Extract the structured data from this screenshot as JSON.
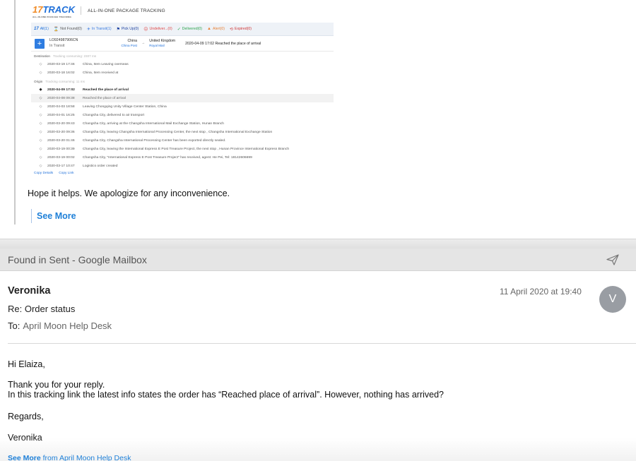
{
  "quoted": {
    "brand_logo": "17TRACK",
    "brand_logo_sub": "ALL-IN-ONE PACKAGE TRACKING",
    "brand_title": "ALL-IN-ONE PACKAGE TRACKING",
    "tabs": [
      {
        "label": "All(1)"
      },
      {
        "label": "Not Found(0)"
      },
      {
        "label": "In Transit(1)"
      },
      {
        "label": "Pick Up(0)"
      },
      {
        "label": "Undeliver...(0)"
      },
      {
        "label": "Delivered(0)"
      },
      {
        "label": "Alert(0)"
      },
      {
        "label": "Expired(0)"
      }
    ],
    "package": {
      "plus": "+",
      "tracking_number": "LO924987906CN",
      "status": "In Transit",
      "origin_country": "China",
      "origin_carrier": "China Post",
      "arrow": "→",
      "dest_country": "United Kingdom",
      "dest_carrier": "Royal Mail",
      "latest": "2020-04-09 17:02  Reached the place of arrival"
    },
    "destination": {
      "label": "Destination",
      "consuming": "Tracking consuming: 2307 ms",
      "events": [
        {
          "time": "2020-03-19 17:46",
          "text": "China, Item Leaving overseas"
        },
        {
          "time": "2020-03-18 16:02",
          "text": "China, Item received at"
        }
      ]
    },
    "origin": {
      "label": "Origin",
      "consuming": "Tracking consuming: 11 ms",
      "events": [
        {
          "time": "2020-04-09 17:02",
          "text": "Reached the place of arrival"
        },
        {
          "time": "2020-04-08 09:38",
          "text": "Reached the place of arrival"
        },
        {
          "time": "2020-04-03 18:58",
          "text": "Leaving Chongqing Unity Village Center Station, China"
        },
        {
          "time": "2020-04-01 16:25",
          "text": "Changsha City, delivered to air transport"
        },
        {
          "time": "2020-03-20 09:43",
          "text": "Changsha City, arriving at the Changsha International Mail Exchange Station, Hunan Branch"
        },
        {
          "time": "2020-03-20 09:36",
          "text": "Changsha City, leaving Changsha International Processing Center, the next stop , Changsha International Exchange Station"
        },
        {
          "time": "2020-03-20 01:46",
          "text": "Changsha City, Changsha International Processing Center has been exported directly sealed."
        },
        {
          "time": "2020-03-19 00:39",
          "text": "Changsha City, leaving the International Express E Post Treasure Project, the next stop , Hunan Province International Express Branch"
        },
        {
          "time": "2020-03-19 00:02",
          "text": "Changsha City, \"International Express E Post Treasure Project\" has received, agent: He Pei, Tel: 18142606699"
        },
        {
          "time": "2020-03-17 10:47",
          "text": "Logistics order created"
        }
      ]
    },
    "copy_details": "Copy Details",
    "copy_link": "Copy Link",
    "hope_text": "Hope it helps. We apologize for any inconvenience.",
    "see_more": "See More"
  },
  "search_header": {
    "text": "Found in Sent - Google Mailbox"
  },
  "email": {
    "sender": "Veronika",
    "date": "11 April 2020 at 19:40",
    "avatar_initial": "V",
    "subject": "Re: Order status",
    "to_label": "To:",
    "to_value": "April Moon Help Desk",
    "body": {
      "greeting": "Hi Elaiza,",
      "line1": "Thank you for your reply.",
      "line2": "In this tracking link the latest info states the order has “Reached place of arrival”. However, nothing has arrived?",
      "regards": "Regards,",
      "signature": "Veronika"
    },
    "see_more_link": "See More",
    "see_more_suffix": " from April Moon Help Desk"
  },
  "colors": {
    "link_blue": "#1f80d8",
    "avatar_grey": "#999da3",
    "header_grey": "#e5e5e5"
  }
}
